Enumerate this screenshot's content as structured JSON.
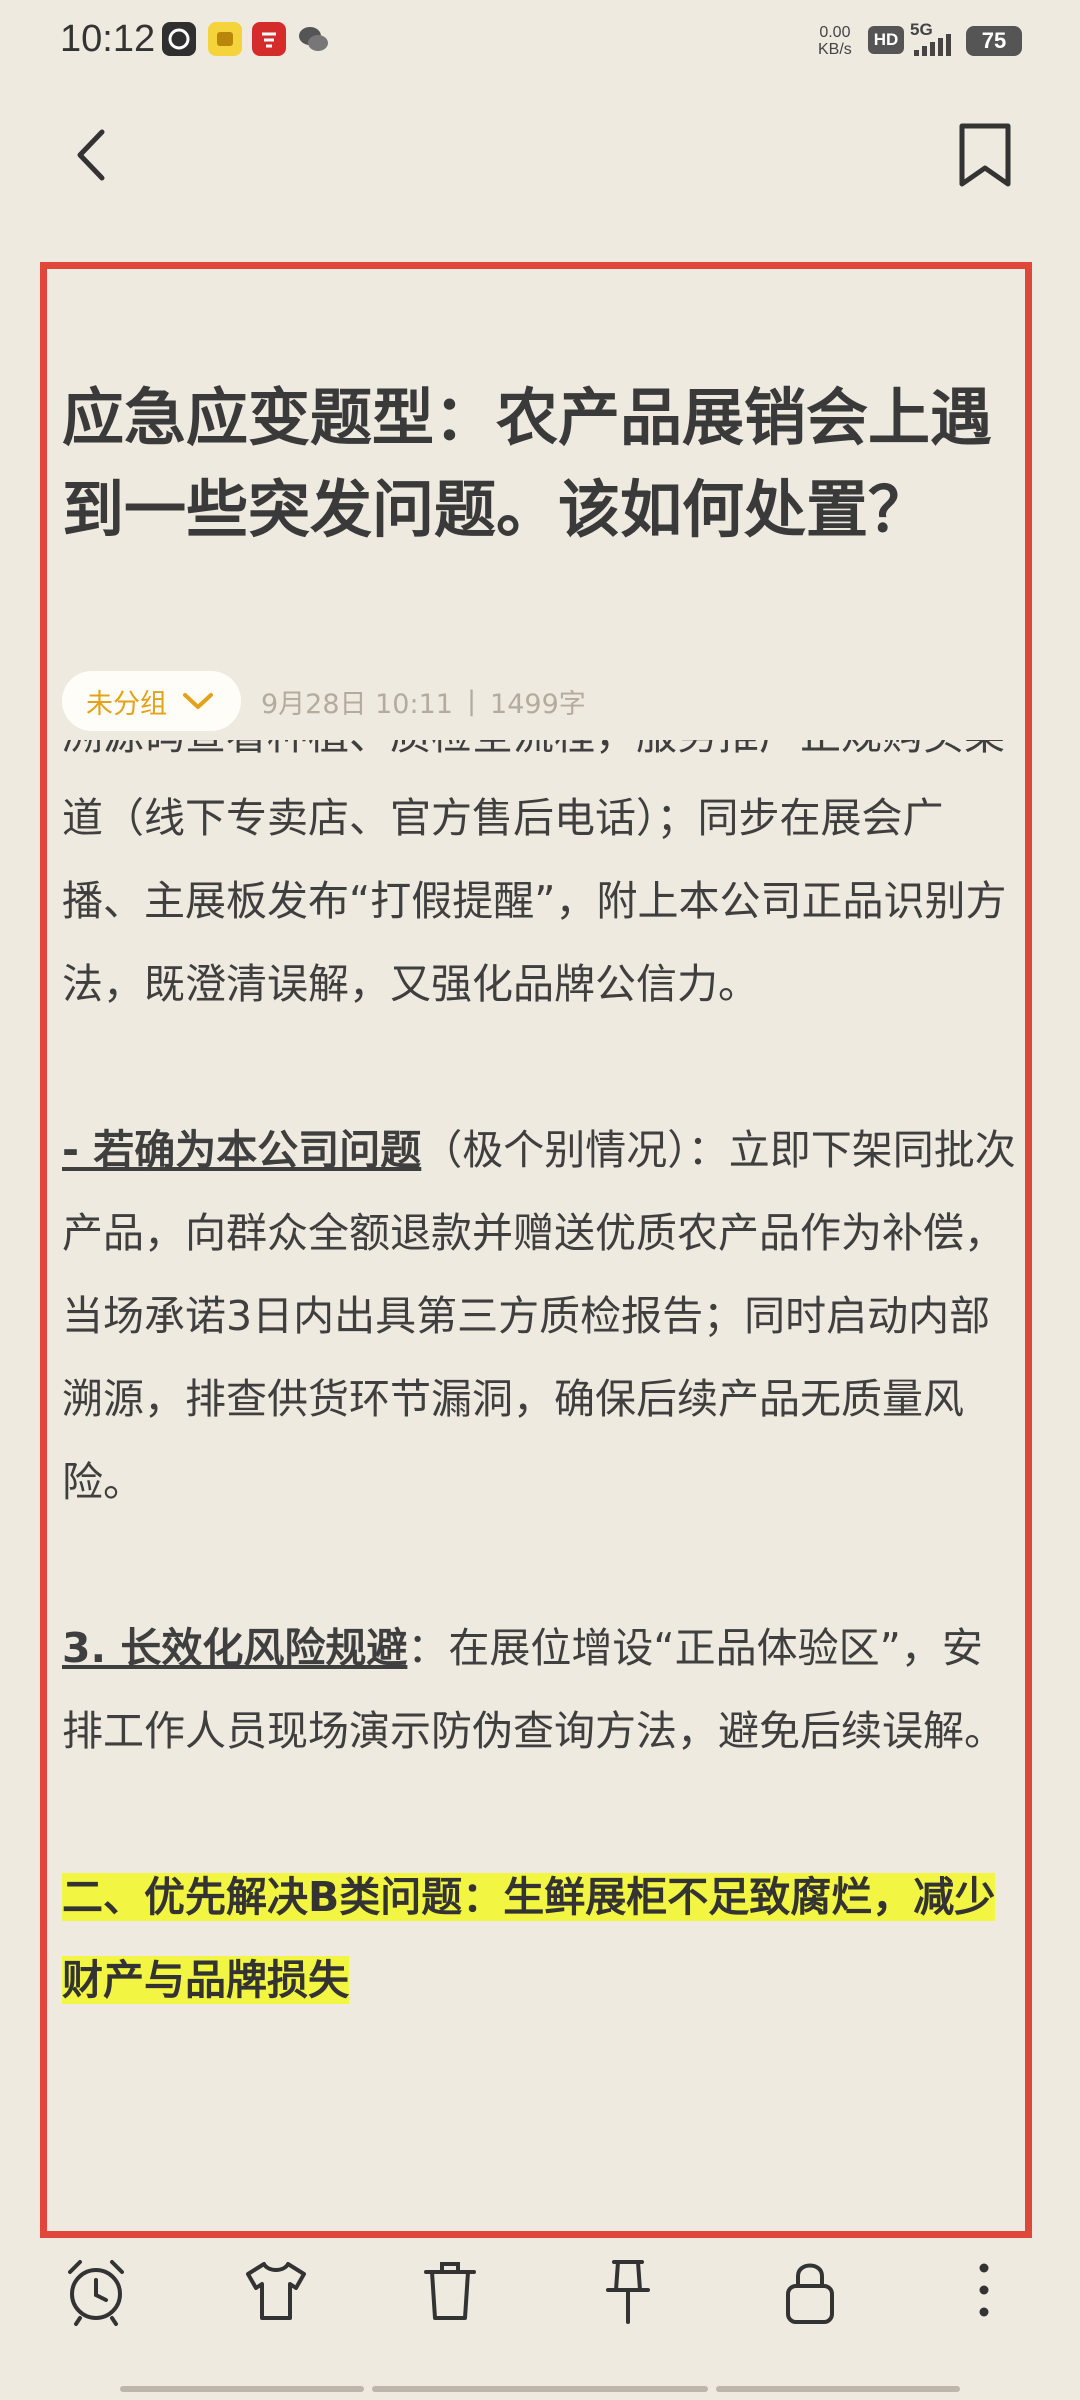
{
  "status_bar": {
    "time": "10:12",
    "net_speed_value": "0.00",
    "net_speed_unit": "KB/s",
    "hd_label": "HD",
    "network_type": "5G",
    "battery": "75",
    "notification_icons": [
      "app-icon",
      "app-icon",
      "app-icon",
      "wechat-icon"
    ]
  },
  "nav": {
    "back_icon": "chevron-left-icon",
    "bookmark_icon": "bookmark-icon"
  },
  "note": {
    "title": "应急应变题型：农产品展销会上遇到一些突发问题。该如何处置？",
    "group": "未分组",
    "date": "9月28日 10:11",
    "separator": "|",
    "word_count": "1499字",
    "paragraphs": [
      {
        "plain": "溯源码查看种植、质检全流程，服务推广正规购买渠道（线下专卖店、官方售后电话）；同步在展会广播、主展板发布“打假提醒”，附上本公司正品识别方法，既澄清误解，又强化品牌公信力。"
      },
      {
        "bold": "- 若确为本公司问题",
        "plain": "（极个别情况）：立即下架同批次产品，向群众全额退款并赠送优质农产品作为补偿，当场承诺3日内出具第三方质检报告；同时启动内部溯源，排查供货环节漏洞，确保后续产品无质量风险。"
      },
      {
        "bold": "3. 长效化风险规避",
        "plain": "：在展位增设“正品体验区”，安排工作人员现场演示防伪查询方法，避免后续误解。"
      }
    ],
    "highlighted_heading": "二、优先解决B类问题：生鲜展柜不足致腐烂，减少财产与品牌损失"
  },
  "toolbar": {
    "icons": [
      "alarm-clock-icon",
      "t-shirt-icon",
      "trash-icon",
      "pin-icon",
      "lock-icon",
      "more-vertical-icon"
    ]
  },
  "colors": {
    "background": "#EFEAE0",
    "frame_red": "#E0463A",
    "accent_orange": "#E3A21A",
    "highlight_yellow": "#F2F542"
  }
}
